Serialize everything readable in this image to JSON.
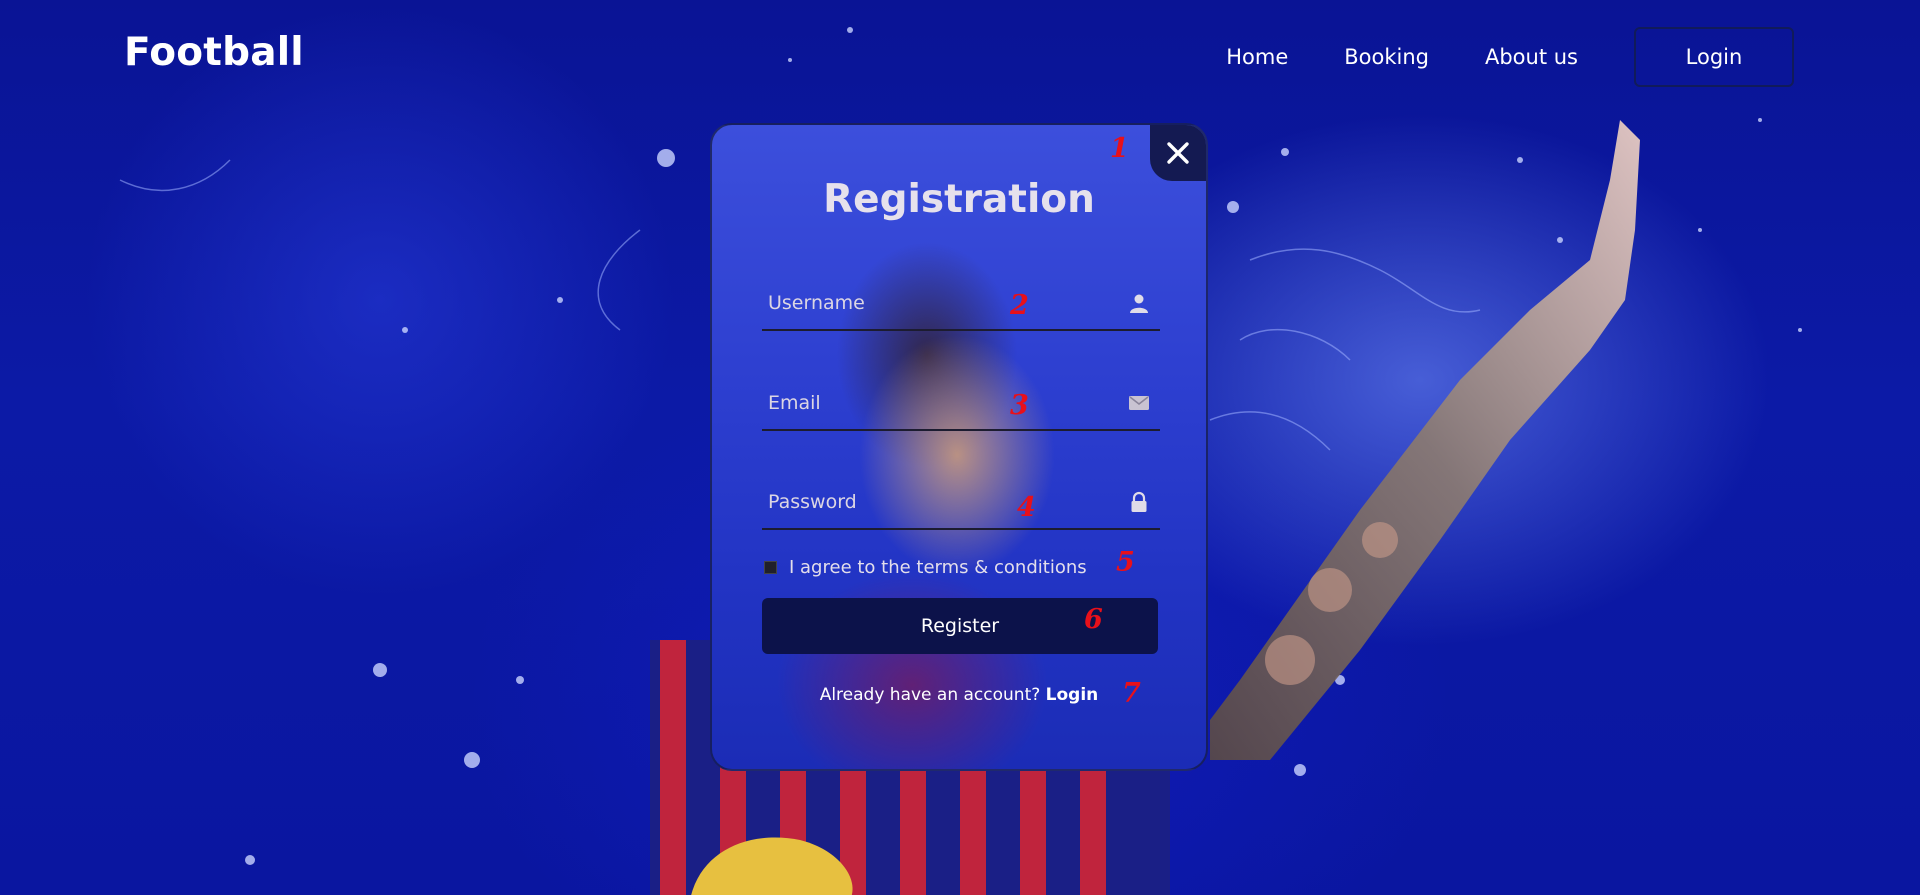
{
  "header": {
    "logo": "Football",
    "nav": {
      "home": "Home",
      "booking": "Booking",
      "about": "About us",
      "login": "Login"
    }
  },
  "modal": {
    "title": "Registration",
    "close_icon": "close-icon",
    "fields": {
      "username": {
        "placeholder": "Username",
        "icon": "user-icon"
      },
      "email": {
        "placeholder": "Email",
        "icon": "envelope-icon"
      },
      "password": {
        "placeholder": "Password",
        "icon": "lock-icon"
      }
    },
    "terms_label": "I agree to the terms & conditions",
    "terms_checked": false,
    "register_label": "Register",
    "switch_prompt": "Already have an account?",
    "switch_link": "Login"
  },
  "annotations": [
    "1",
    "2",
    "3",
    "4",
    "5",
    "6",
    "7"
  ],
  "colors": {
    "background": "#0c1aa6",
    "button": "#0c124a",
    "close_button": "#141a52",
    "annotation": "#e8101a",
    "text": "#ffffff"
  }
}
